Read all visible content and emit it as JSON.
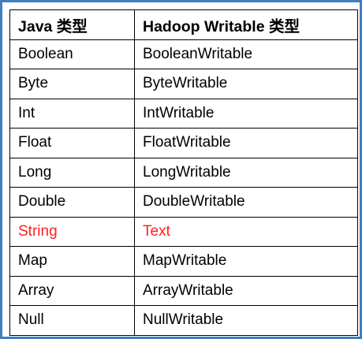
{
  "table": {
    "headers": [
      "Java 类型",
      "Hadoop Writable 类型"
    ],
    "rows": [
      {
        "java": "Boolean",
        "writable": "BooleanWritable",
        "highlight": false
      },
      {
        "java": "Byte",
        "writable": "ByteWritable",
        "highlight": false
      },
      {
        "java": "Int",
        "writable": "IntWritable",
        "highlight": false
      },
      {
        "java": "Float",
        "writable": "FloatWritable",
        "highlight": false
      },
      {
        "java": "Long",
        "writable": "LongWritable",
        "highlight": false
      },
      {
        "java": "Double",
        "writable": "DoubleWritable",
        "highlight": false
      },
      {
        "java": "String",
        "writable": "Text",
        "highlight": true
      },
      {
        "java": "Map",
        "writable": "MapWritable",
        "highlight": false
      },
      {
        "java": "Array",
        "writable": "ArrayWritable",
        "highlight": false
      },
      {
        "java": "Null",
        "writable": "NullWritable",
        "highlight": false
      }
    ]
  },
  "colors": {
    "frame_border": "#3f7fbf",
    "highlight_text": "#ff1f1f",
    "grid": "#000000"
  }
}
